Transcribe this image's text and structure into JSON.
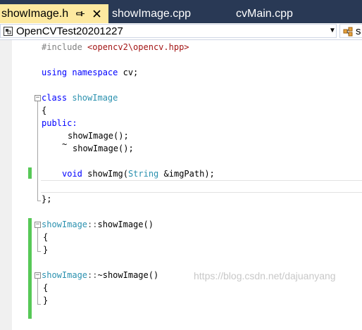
{
  "tabs": [
    {
      "label": "showImage.h",
      "active": true
    },
    {
      "label": "showImage.cpp",
      "active": false
    },
    {
      "label": "cvMain.cpp",
      "active": false
    }
  ],
  "navbar": {
    "project": "OpenCVTest20201227",
    "class_scope": "s"
  },
  "code": {
    "include_kw": "#include",
    "include_path": "<opencv2\\opencv.hpp>",
    "using_kw": "using namespace",
    "using_ns": "cv;",
    "class_kw": "class",
    "class_name": "showImage",
    "open_brace": "{",
    "public_kw": "public:",
    "ctor": "showImage();",
    "dtor_tilde": "~",
    "dtor": "showImage();",
    "void_kw": "void",
    "method": "showImg(",
    "param_type": "String",
    "param_rest": "&imgPath);",
    "class_close": "};",
    "ctor_def_class": "showImage",
    "ctor_def_sep": "::",
    "ctor_def_name": "showImage()",
    "brace_open": "{",
    "brace_close": "}",
    "dtor_def_class": "showImage",
    "dtor_def_sep": "::",
    "dtor_def_tilde": "~",
    "dtor_def_name": "showImage()"
  },
  "watermark": "https://blog.csdn.net/dajuanyang",
  "colors": {
    "tab_strip": "#293955",
    "active_tab": "#fde9a0",
    "keyword": "#0000ff",
    "type": "#2b91af",
    "string": "#a31515",
    "change_saved": "#57c857"
  }
}
